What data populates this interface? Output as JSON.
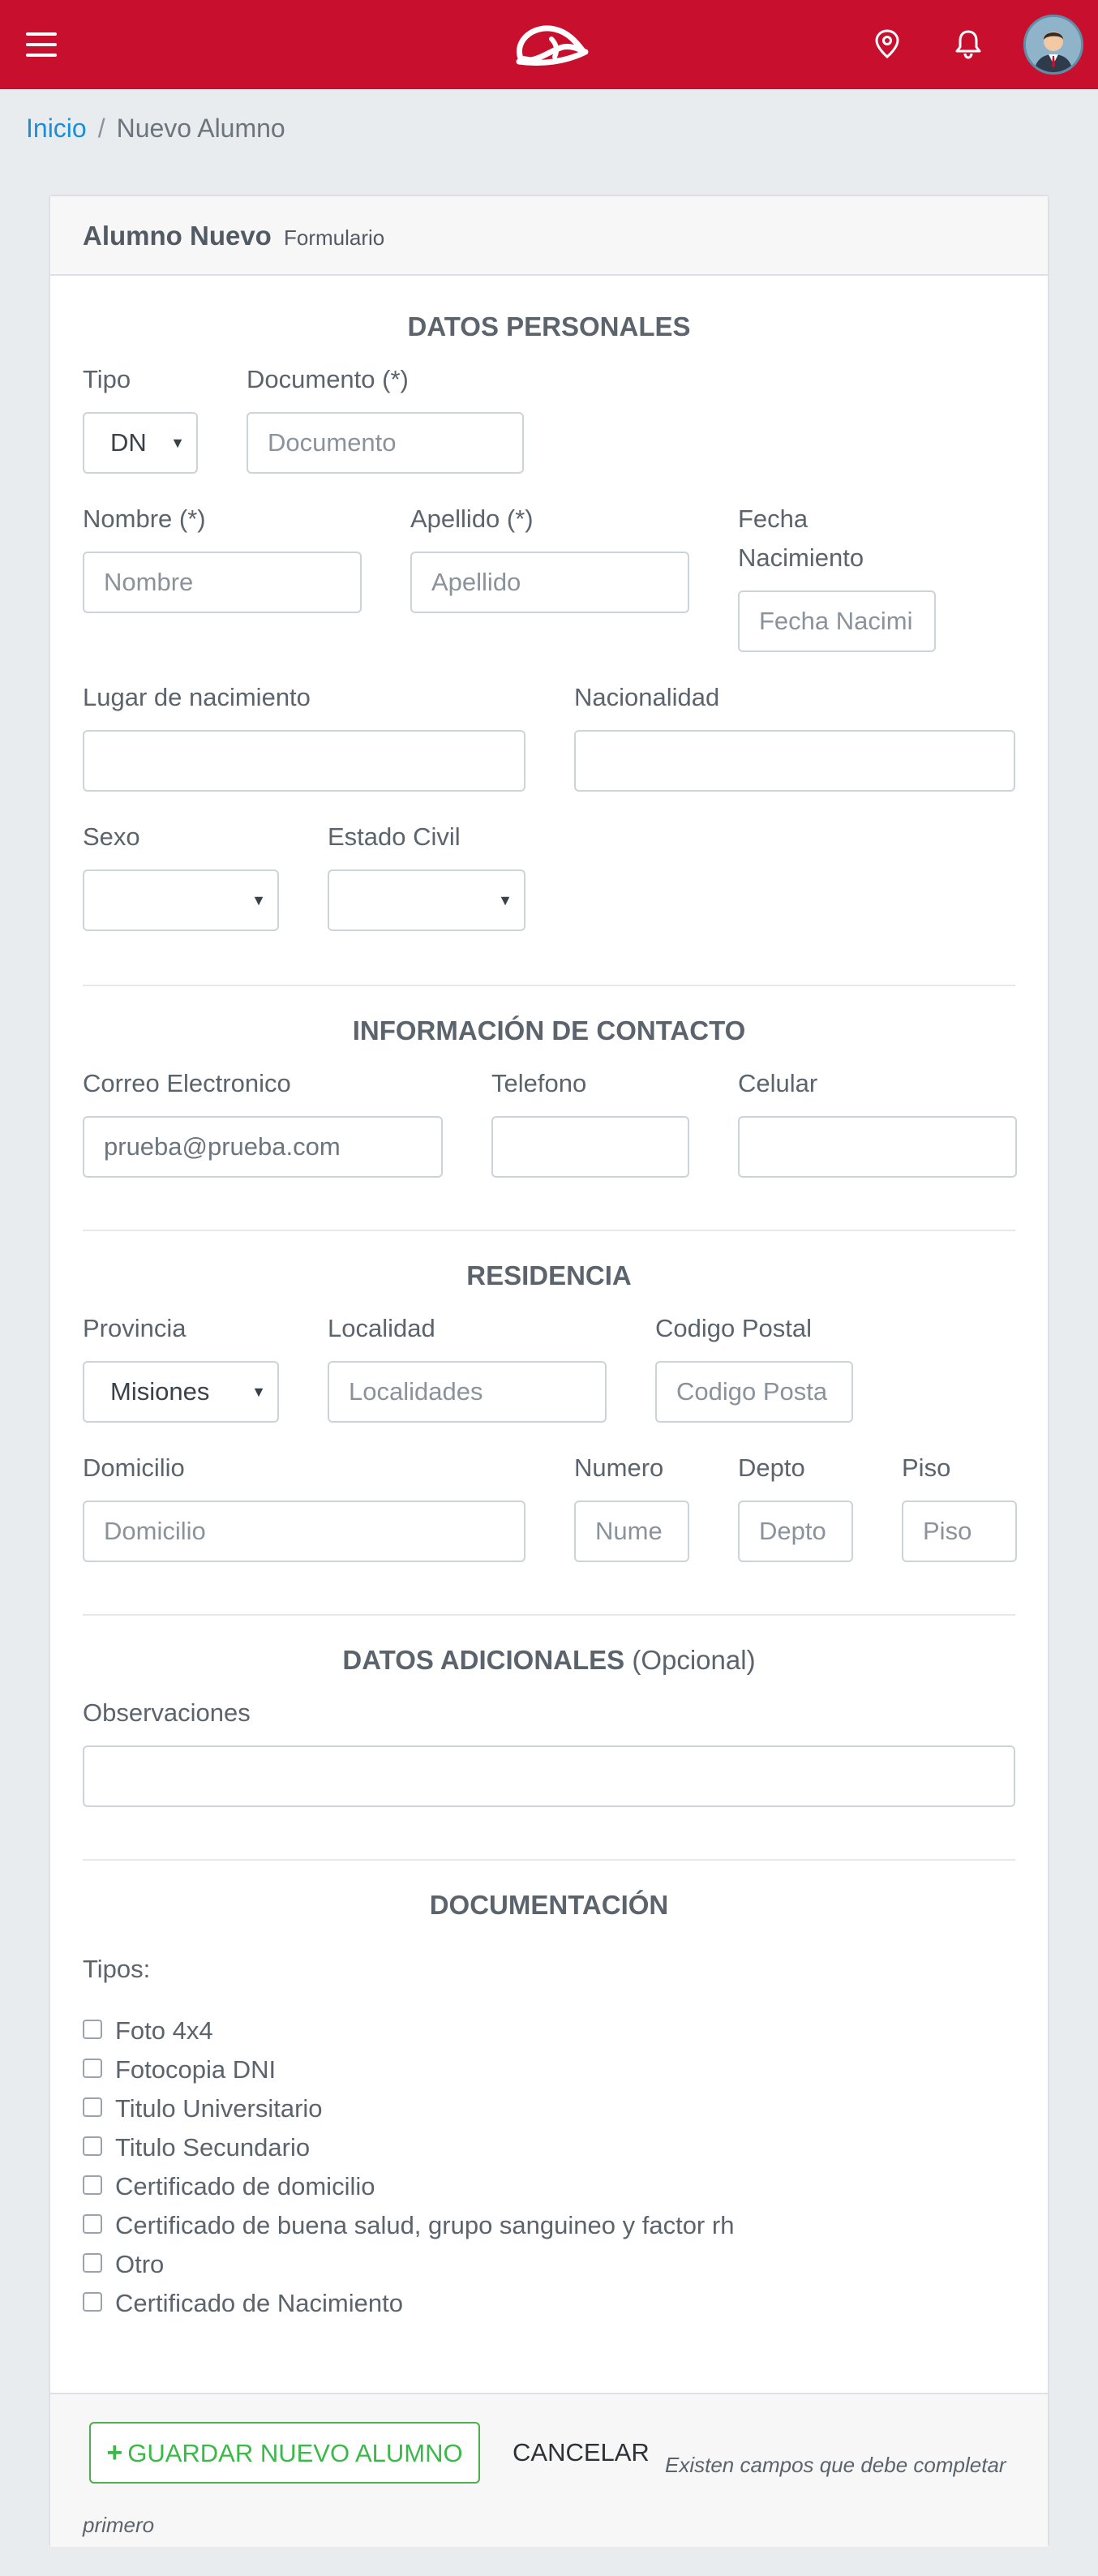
{
  "header": {
    "menu_icon": "hamburger-icon",
    "logo_icon": "brand-logo",
    "location_icon": "map-pin-icon",
    "notification_icon": "bell-icon",
    "avatar_icon": "user-avatar",
    "brand_color": "#c8102e"
  },
  "breadcrumb": {
    "home": "Inicio",
    "separator": "/",
    "current": "Nuevo Alumno"
  },
  "card": {
    "title": "Alumno Nuevo",
    "subtitle": "Formulario"
  },
  "personal": {
    "section_title": "DATOS PERSONALES",
    "tipo_label": "Tipo",
    "tipo_value": "DN",
    "documento_label": "Documento (*)",
    "documento_placeholder": "Documento",
    "nombre_label": "Nombre (*)",
    "nombre_placeholder": "Nombre",
    "apellido_label": "Apellido (*)",
    "apellido_placeholder": "Apellido",
    "fecha_label_1": "Fecha",
    "fecha_label_2": "Nacimiento",
    "fecha_placeholder": "Fecha Nacimi",
    "lugar_label": "Lugar de nacimiento",
    "nacionalidad_label": "Nacionalidad",
    "sexo_label": "Sexo",
    "estado_civil_label": "Estado Civil"
  },
  "contacto": {
    "section_title": "INFORMACIÓN DE CONTACTO",
    "correo_label": "Correo Electronico",
    "correo_value": "prueba@prueba.com",
    "telefono_label": "Telefono",
    "celular_label": "Celular"
  },
  "residencia": {
    "section_title": "RESIDENCIA",
    "provincia_label": "Provincia",
    "provincia_value": "Misiones",
    "localidad_label": "Localidad",
    "localidad_placeholder": "Localidades",
    "codigo_postal_label": "Codigo Postal",
    "codigo_postal_placeholder": "Codigo Posta",
    "domicilio_label": "Domicilio",
    "domicilio_placeholder": "Domicilio",
    "numero_label": "Numero",
    "numero_placeholder": "Nume",
    "depto_label": "Depto",
    "depto_placeholder": "Depto",
    "piso_label": "Piso",
    "piso_placeholder": "Piso"
  },
  "adicionales": {
    "section_title": "DATOS ADICIONALES",
    "section_optional": "(Opcional)",
    "observaciones_label": "Observaciones"
  },
  "documentacion": {
    "section_title": "DOCUMENTACIÓN",
    "tipos_label": "Tipos:",
    "items": [
      "Foto 4x4",
      "Fotocopia DNI",
      "Titulo Universitario",
      "Titulo Secundario",
      "Certificado de domicilio",
      "Certificado de buena salud, grupo sanguineo y factor rh",
      "Otro",
      "Certificado de Nacimiento"
    ]
  },
  "footer": {
    "save_icon": "plus-icon",
    "save_label": "GUARDAR NUEVO ALUMNO",
    "cancel_label": "CANCELAR",
    "note": "Existen campos que debe completar primero"
  }
}
